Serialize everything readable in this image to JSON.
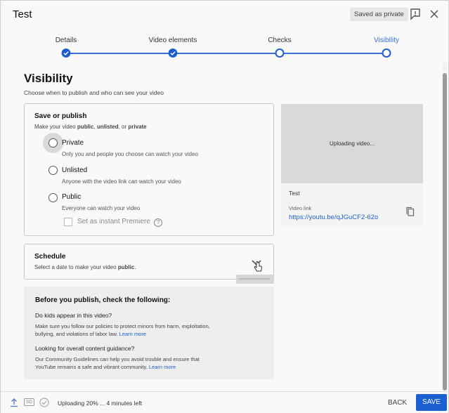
{
  "header": {
    "title": "Test",
    "saved_chip": "Saved as private"
  },
  "stepper": {
    "steps": [
      {
        "label": "Details",
        "state": "done"
      },
      {
        "label": "Video elements",
        "state": "done"
      },
      {
        "label": "Checks",
        "state": "open"
      },
      {
        "label": "Visibility",
        "state": "current"
      }
    ]
  },
  "page": {
    "title": "Visibility",
    "subtitle": "Choose when to publish and who can see your video"
  },
  "save_publish": {
    "title": "Save or publish",
    "subtitle_pre": "Make your video ",
    "subtitle_public": "public",
    "subtitle_sep1": ", ",
    "subtitle_unlisted": "unlisted",
    "subtitle_sep2": ", or ",
    "subtitle_private": "private",
    "options": [
      {
        "label": "Private",
        "desc": "Only you and people you choose can watch your video",
        "selected": false
      },
      {
        "label": "Unlisted",
        "desc": "Anyone with the video link can watch your video",
        "selected": false
      },
      {
        "label": "Public",
        "desc": "Everyone can watch your video",
        "selected": false
      }
    ],
    "premiere_label": "Set as instant Premiere",
    "help_glyph": "?"
  },
  "schedule": {
    "title": "Schedule",
    "subtitle_pre": "Select a date to make your video ",
    "subtitle_bold": "public",
    "subtitle_post": "."
  },
  "preview": {
    "uploading": "Uploading video...",
    "video_title": "Test",
    "link_label": "Video link",
    "link": "https://youtu.be/qJGuCF2-62o"
  },
  "checklist": {
    "heading": "Before you publish, check the following:",
    "q1": "Do kids appear in this video?",
    "p1_line1": "Make sure you follow our policies to protect minors from harm, exploitation,",
    "p1_line2": "bullying, and violations of labor law.",
    "p1_link": "Learn more",
    "q2": "Looking for overall content guidance?",
    "p2_line1": "Our Community Guidelines can help you avoid trouble and ensure that",
    "p2_line2": "YouTube remains a safe and vibrant community.",
    "p2_link": "Learn more"
  },
  "footer": {
    "hd_badge": "SD",
    "status": "Uploading 20% ... 4 minutes left",
    "back": "BACK",
    "save": "SAVE"
  },
  "colors": {
    "accent": "#1c5fd2",
    "link": "#1d5fd0",
    "background": "#f9f9f9"
  }
}
